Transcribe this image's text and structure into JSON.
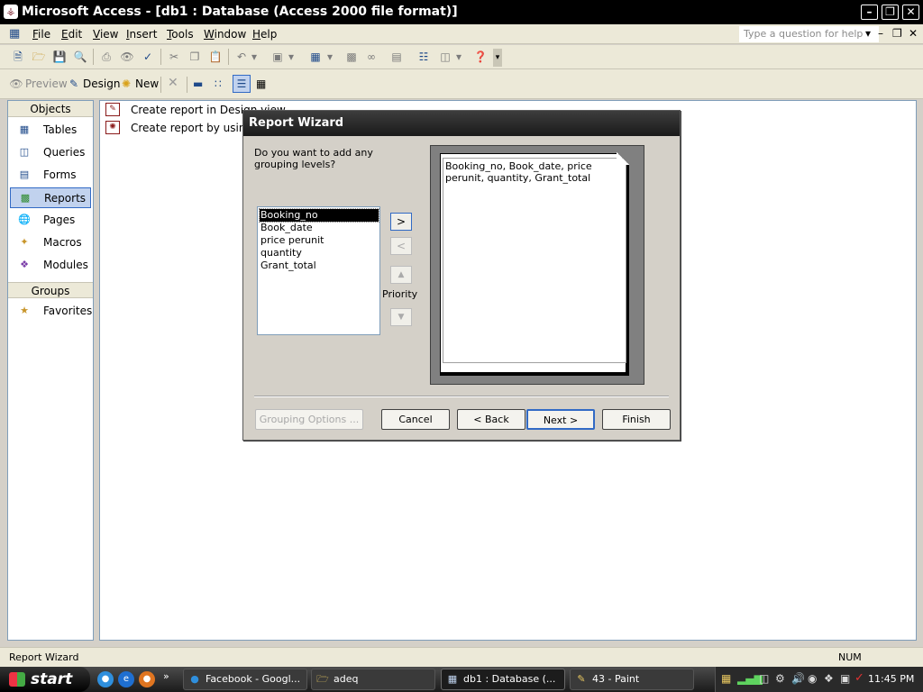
{
  "window": {
    "title": "Microsoft Access - [db1 : Database (Access 2000 file format)]"
  },
  "menu": {
    "items": [
      {
        "label": "File",
        "u": "F",
        "rest": "ile"
      },
      {
        "label": "Edit",
        "u": "E",
        "rest": "dit"
      },
      {
        "label": "View",
        "u": "V",
        "rest": "iew"
      },
      {
        "label": "Insert",
        "u": "I",
        "rest": "nsert"
      },
      {
        "label": "Tools",
        "u": "T",
        "rest": "ools"
      },
      {
        "label": "Window",
        "u": "W",
        "rest": "indow"
      },
      {
        "label": "Help",
        "u": "H",
        "rest": "elp"
      }
    ],
    "help_placeholder": "Type a question for help"
  },
  "dbbar": {
    "preview": "Preview",
    "design": "Design",
    "new": "New"
  },
  "objects": {
    "header": "Objects",
    "items": [
      "Tables",
      "Queries",
      "Forms",
      "Reports",
      "Pages",
      "Macros",
      "Modules"
    ],
    "groups_header": "Groups",
    "favorites": "Favorites"
  },
  "list": {
    "items": [
      "Create report in Design view",
      "Create report by using wizard"
    ]
  },
  "dialog": {
    "title": "Report Wizard",
    "question": "Do you want to add any grouping levels?",
    "fields": [
      "Booking_no",
      "Book_date",
      "price perunit",
      "quantity",
      "Grant_total"
    ],
    "add": ">",
    "remove": "<",
    "priority": "Priority",
    "preview_text": "Booking_no, Book_date, price perunit, quantity, Grant_total",
    "buttons": {
      "grouping": "Grouping Options ...",
      "cancel": "Cancel",
      "back": "< Back",
      "next": "Next >",
      "finish": "Finish"
    }
  },
  "status": {
    "left": "Report Wizard",
    "num": "NUM"
  },
  "taskbar": {
    "start": "start",
    "tasks": [
      "Facebook - Googl...",
      "adeq",
      "db1 : Database (...",
      "43 - Paint"
    ],
    "clock": "11:45 PM"
  },
  "colors": {
    "titlebar": "#000000",
    "selection": "#316ac5",
    "desktop": "#d4d0c8"
  }
}
